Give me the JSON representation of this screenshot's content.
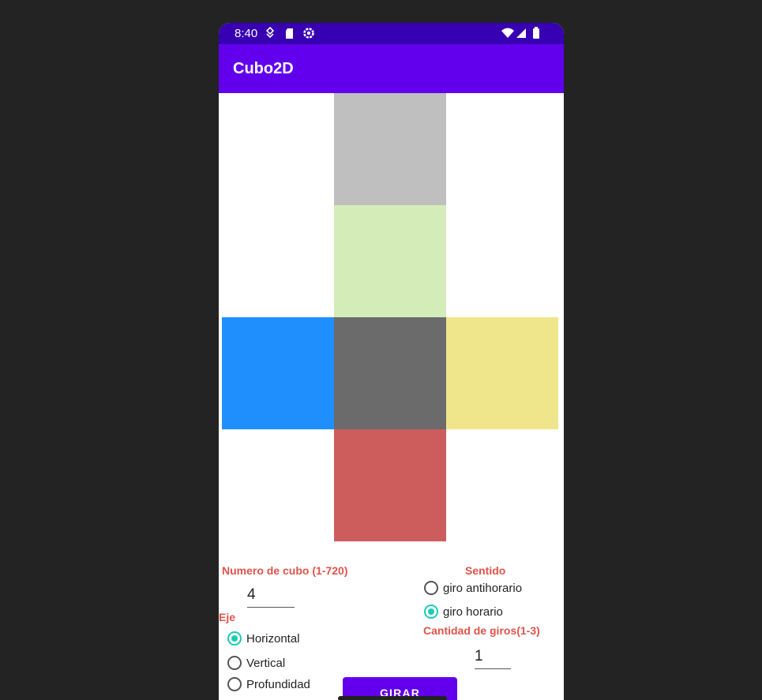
{
  "status_bar": {
    "time": "8:40",
    "left_icons": [
      "data-saver-icon",
      "sd-card-icon",
      "settings-gear-icon"
    ],
    "right_icons": [
      "wifi-icon",
      "cell-signal-icon",
      "battery-icon"
    ]
  },
  "app_bar": {
    "title": "Cubo2D",
    "color": "#6200ee",
    "status_color": "#3700b3"
  },
  "cube_net": {
    "faces": [
      {
        "name": "top",
        "color": "#bfbfbf"
      },
      {
        "name": "upper",
        "color": "#d4ecb8"
      },
      {
        "name": "left",
        "color": "#1f8ffe"
      },
      {
        "name": "center",
        "color": "#6b6b6b"
      },
      {
        "name": "right",
        "color": "#efe68c"
      },
      {
        "name": "bottom",
        "color": "#cd5d5c"
      }
    ]
  },
  "controls": {
    "cube_number_label": "Numero de cubo (1-720)",
    "cube_number_value": "4",
    "axis_label": "Eje",
    "axis_options": [
      {
        "label": "Horizontal",
        "selected": true
      },
      {
        "label": "Vertical",
        "selected": false
      },
      {
        "label": "Profundidad",
        "selected": false
      }
    ],
    "direction_label": "Sentido",
    "direction_options": [
      {
        "label": "giro antihorario",
        "selected": false
      },
      {
        "label": "giro horario",
        "selected": true
      }
    ],
    "turns_label": "Cantidad de giros(1-3)",
    "turns_value": "1",
    "button_label": "GIRAR"
  }
}
